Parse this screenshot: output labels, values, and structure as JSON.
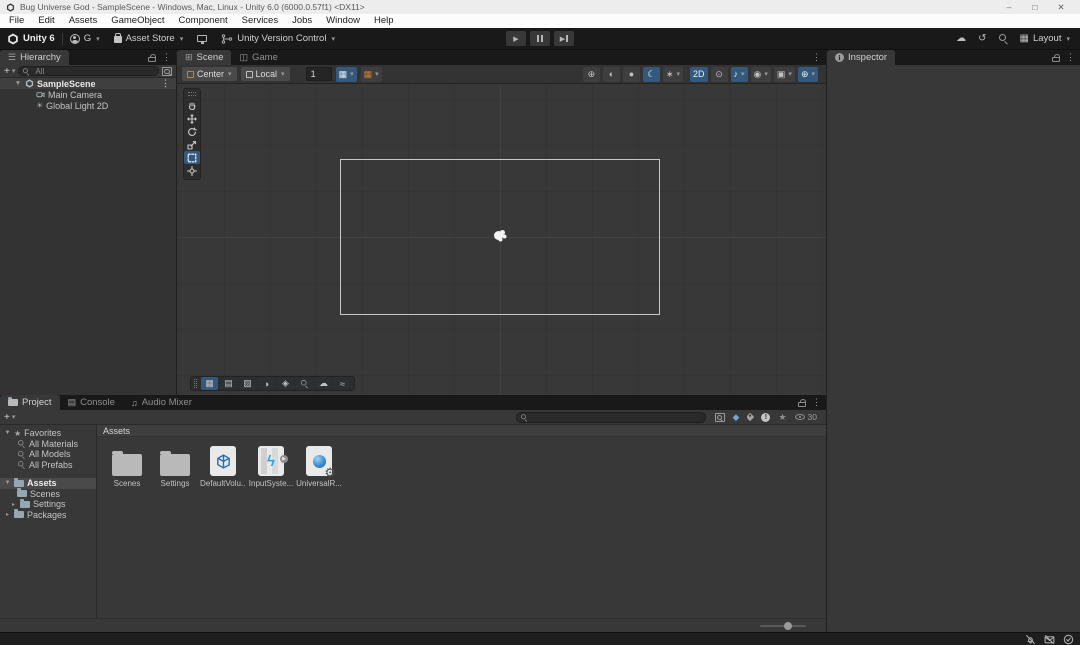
{
  "colors": {
    "accent_blue": "#35597c",
    "accent_orange": "#c57f35",
    "selection_gray": "#4a4a4a",
    "panel_bg": "#383838",
    "chrome_bg": "#191919"
  },
  "glyphs": {
    "hamburger": "☰",
    "kebab": "⋮",
    "dropdown": "▾",
    "tree_open": "▼",
    "tree_closed": "▸",
    "plus": "+",
    "play": "▶",
    "cloud": "☁",
    "history": "↺",
    "layout_grid": "▦",
    "scene_tab": "⊞",
    "game_tab": "◫",
    "console_tab": "▤",
    "audio_tab": "♫",
    "circle_cross": "⊕",
    "circle_half": "◐",
    "circle_full": "●",
    "moon": "☾",
    "flare": "∗",
    "bulb": "⊙",
    "note": "♪",
    "eye": "◉",
    "camera_box": "▣",
    "gizmo": "⊕",
    "star": "★",
    "sun": "☀",
    "warn": "!",
    "diamond": "◆",
    "grid_snap": "▦",
    "gear": "⚙",
    "bolt": "ϟ",
    "info": "i",
    "overlay": [
      "▦",
      "▤",
      "▨",
      "◑",
      "◈",
      "⊙",
      "☁",
      "≈"
    ]
  },
  "window": {
    "title": "Bug Universe God - SampleScene - Windows, Mac, Linux - Unity 6.0 (6000.0.57f1) <DX11>",
    "minimize": "–",
    "maximize": "□",
    "close": "✕"
  },
  "menubar": {
    "items": [
      "File",
      "Edit",
      "Assets",
      "GameObject",
      "Component",
      "Services",
      "Jobs",
      "Window",
      "Help"
    ]
  },
  "toolbar": {
    "product": "Unity 6",
    "account": "G",
    "asset_store": "Asset Store",
    "version_control": "Unity Version Control",
    "layout": "Layout"
  },
  "hierarchy": {
    "tab": "Hierarchy",
    "search_placeholder": "All",
    "scene_name": "SampleScene",
    "items": [
      "Main Camera",
      "Global Light 2D"
    ]
  },
  "scene": {
    "tab_scene": "Scene",
    "tab_game": "Game",
    "pivot": "Center",
    "orientation": "Local",
    "snap_value": "1",
    "mode_2d": "2D"
  },
  "inspector": {
    "tab": "Inspector"
  },
  "project": {
    "tab_project": "Project",
    "tab_console": "Console",
    "tab_audio": "Audio Mixer",
    "favorites_label": "Favorites",
    "favorites": [
      "All Materials",
      "All Models",
      "All Prefabs"
    ],
    "assets_root": "Assets",
    "tree_children": [
      "Scenes",
      "Settings"
    ],
    "packages_label": "Packages",
    "grid_header": "Assets",
    "assets": [
      "Scenes",
      "Settings",
      "DefaultVolu...",
      "InputSyste...",
      "UniversalR..."
    ],
    "hidden_count": "30"
  }
}
